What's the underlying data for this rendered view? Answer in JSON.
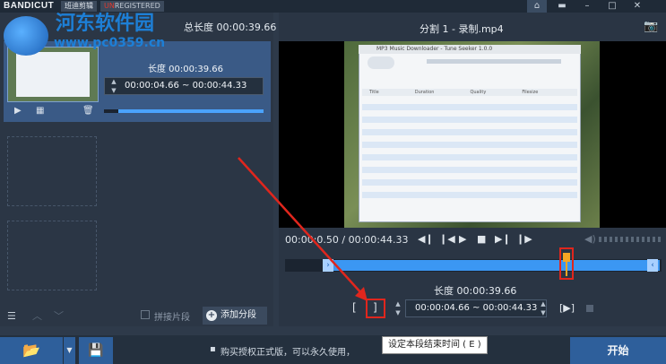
{
  "app": {
    "brand": "BANDICUT",
    "mode_tag": "班迪剪辑",
    "reg_tag_prefix": "UN",
    "reg_tag_rest": "REGISTERED",
    "watermark_line1": "河东软件园",
    "watermark_line2": "www.pc0359.cn"
  },
  "left_panel": {
    "total_duration": "总长度 00:00:39.66",
    "segment": {
      "length_label": "长度 00:00:39.66",
      "range_start": "00:00:04.66",
      "range_sep": "~",
      "range_end": "00:00:44.33",
      "bar_fill_fraction": 0.91
    },
    "merge_label": "拼接片段",
    "add_segment_label": "添加分段"
  },
  "right_panel": {
    "file_title": "分割 1 - 录制.mp4",
    "time_display": "00:00:0",
    "time_display_rest": ".50 / 00:00:44.33",
    "length_label": "长度 00:00:39.66",
    "range_start": "00:00:04.66",
    "range_sep": "~",
    "range_end": "00:00:44.33",
    "start_bracket": "[",
    "end_bracket": "]",
    "play_segment": "[▶]"
  },
  "video_window": {
    "title": "MP3 Music Downloader - Tune Seeker 1.0.0",
    "header_cols": [
      "Title",
      "Duration",
      "Quality",
      "Filesize"
    ]
  },
  "bottom": {
    "notice": "购买授权正式版，可以永久使用，",
    "tooltip": "设定本段结束时间 ( E )",
    "start_label": "开始"
  },
  "colors": {
    "accent": "#3b97f3",
    "marker": "#f5a623",
    "annotation": "#e0261d"
  }
}
